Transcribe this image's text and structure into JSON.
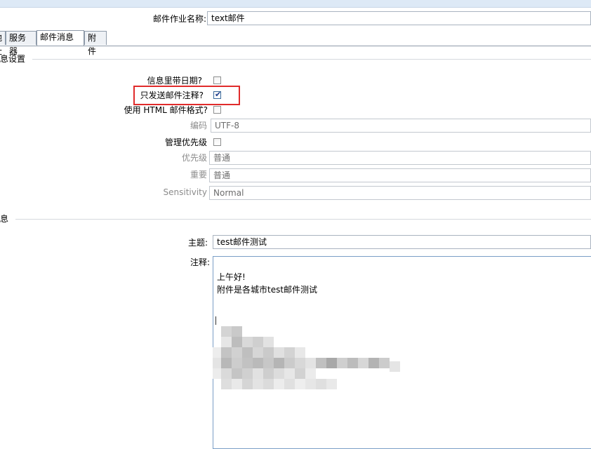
{
  "header": {
    "job_name_label": "邮件作业名称:",
    "job_name_value": "text邮件"
  },
  "tabs": [
    {
      "label": "地址"
    },
    {
      "label": "服务器"
    },
    {
      "label": "邮件消息"
    },
    {
      "label": "附件"
    }
  ],
  "message_settings": {
    "section_title": "消息设置",
    "include_date_label": "信息里带日期?",
    "include_date_checked": false,
    "only_comment_label": "只发送邮件注释?",
    "only_comment_checked": true,
    "html_format_label": "使用 HTML 邮件格式?",
    "html_format_checked": false,
    "encoding_label": "编码",
    "encoding_value": "UTF-8",
    "manage_priority_label": "管理优先级",
    "manage_priority_checked": false,
    "priority_label": "优先级",
    "priority_value": "普通",
    "importance_label": "重要",
    "importance_value": "普通",
    "sensitivity_label": "Sensitivity",
    "sensitivity_value": "Normal"
  },
  "message": {
    "section_title": "消息",
    "subject_label": "主题:",
    "subject_value": "test邮件测试",
    "comment_label": "注释:",
    "comment_lines": [
      "上午好!",
      "附件是各城市test邮件测试"
    ]
  },
  "colors": {
    "highlight_border": "#e02b2b",
    "field_border": "#a9b3c0",
    "textarea_border": "#7a9ec7"
  }
}
